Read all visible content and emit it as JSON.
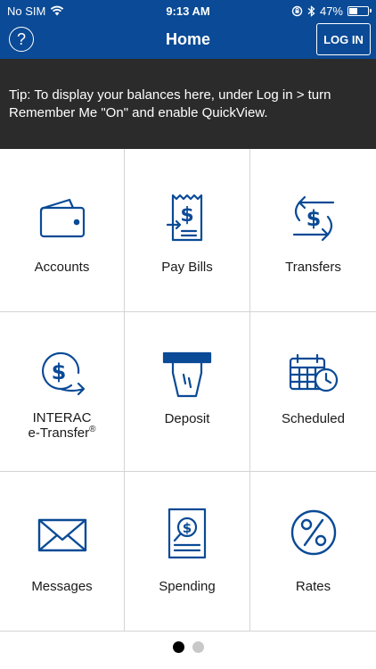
{
  "status_bar": {
    "carrier": "No SIM",
    "time": "9:13 AM",
    "battery": "47%",
    "battery_level": 0.47
  },
  "nav": {
    "help_label": "?",
    "title": "Home",
    "login_label": "LOG IN"
  },
  "tip": {
    "text": "Tip: To display your balances here, under Log in > turn Remember Me \"On\" and enable QuickView."
  },
  "tiles": [
    {
      "label": "Accounts",
      "icon": "wallet-icon"
    },
    {
      "label": "Pay Bills",
      "icon": "bill-receipt-icon"
    },
    {
      "label": "Transfers",
      "icon": "transfer-arrows-icon"
    },
    {
      "label_line1": "INTERAC",
      "label_line2": "e-Transfer",
      "label_mark": "®",
      "icon": "etransfer-dollar-icon"
    },
    {
      "label": "Deposit",
      "icon": "deposit-cheque-icon"
    },
    {
      "label": "Scheduled",
      "icon": "calendar-clock-icon"
    },
    {
      "label": "Messages",
      "icon": "envelope-icon"
    },
    {
      "label": "Spending",
      "icon": "spending-report-icon"
    },
    {
      "label": "Rates",
      "icon": "percent-icon"
    }
  ],
  "pager": {
    "pages": 2,
    "current": 1
  },
  "colors": {
    "brand": "#0a4a96",
    "icon": "#0a4a96",
    "tip_bg": "#2b2b2b"
  }
}
